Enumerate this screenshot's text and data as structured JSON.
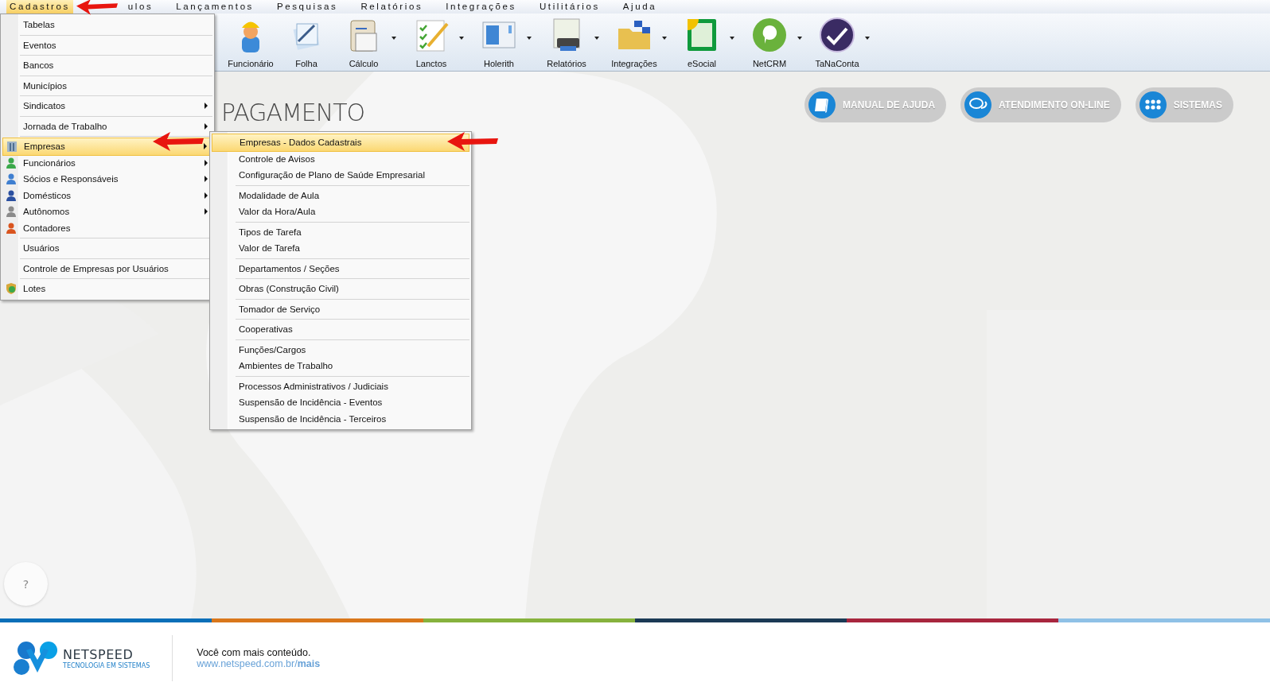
{
  "menubar": [
    {
      "label": "Cadastros",
      "selected": true
    },
    {
      "label": "ulos",
      "selected": false
    },
    {
      "label": "Lançamentos",
      "selected": false
    },
    {
      "label": "Pesquisas",
      "selected": false
    },
    {
      "label": "Relatórios",
      "selected": false
    },
    {
      "label": "Integrações",
      "selected": false
    },
    {
      "label": "Utilitários",
      "selected": false
    },
    {
      "label": "Ajuda",
      "selected": false
    }
  ],
  "toolbar": [
    {
      "label": "Funcionário",
      "kind": "worker",
      "dropdown": false
    },
    {
      "label": "Folha",
      "kind": "pages",
      "dropdown": false
    },
    {
      "label": "Cálculo",
      "kind": "calculator",
      "dropdown": true
    },
    {
      "label": "Lanctos",
      "kind": "checklist",
      "dropdown": true
    },
    {
      "label": "Holerith",
      "kind": "window",
      "dropdown": true
    },
    {
      "label": "Relatórios",
      "kind": "printer",
      "dropdown": true
    },
    {
      "label": "Integrações",
      "kind": "folder",
      "dropdown": true
    },
    {
      "label": "eSocial",
      "kind": "esocial",
      "dropdown": true
    },
    {
      "label": "NetCRM",
      "kind": "chat",
      "dropdown": true
    },
    {
      "label": "TaNaConta",
      "kind": "check",
      "dropdown": true
    }
  ],
  "page_heading": "PAGAMENTO",
  "help_buttons": [
    {
      "label": "MANUAL DE AJUDA",
      "kind": "book"
    },
    {
      "label": "ATENDIMENTO ON-LINE",
      "kind": "chat"
    },
    {
      "label": "SISTEMAS",
      "kind": "grid"
    }
  ],
  "help_circle": "?",
  "cadastros_menu": [
    [
      {
        "label": "Tabelas",
        "kind": "plain",
        "submenu": false,
        "selected": false
      }
    ],
    [
      {
        "label": "Eventos",
        "kind": "plain",
        "submenu": false,
        "selected": false
      }
    ],
    [
      {
        "label": "Bancos",
        "kind": "plain",
        "submenu": false,
        "selected": false
      }
    ],
    [
      {
        "label": "Municípios",
        "kind": "plain",
        "submenu": false,
        "selected": false
      }
    ],
    [
      {
        "label": "Sindicatos",
        "kind": "plain",
        "submenu": true,
        "selected": false
      }
    ],
    [
      {
        "label": "Jornada de Trabalho",
        "kind": "plain",
        "submenu": true,
        "selected": false
      }
    ],
    [
      {
        "label": "Empresas",
        "kind": "building",
        "submenu": true,
        "selected": true
      },
      {
        "label": "Funcionários",
        "kind": "person",
        "color": "#3aa84a",
        "submenu": true,
        "selected": false
      },
      {
        "label": "Sócios e Responsáveis",
        "kind": "person",
        "color": "#3f7fd0",
        "submenu": true,
        "selected": false
      },
      {
        "label": "Domésticos",
        "kind": "person",
        "color": "#2a4fa0",
        "submenu": true,
        "selected": false
      },
      {
        "label": "Autônomos",
        "kind": "person",
        "color": "#8a8a8a",
        "submenu": true,
        "selected": false
      },
      {
        "label": "Contadores",
        "kind": "person",
        "color": "#d9541e",
        "submenu": false,
        "selected": false
      }
    ],
    [
      {
        "label": "Usuários",
        "kind": "plain",
        "submenu": false,
        "selected": false
      }
    ],
    [
      {
        "label": "Controle de Empresas por Usuários",
        "kind": "plain",
        "submenu": false,
        "selected": false
      }
    ],
    [
      {
        "label": "Lotes",
        "kind": "shield",
        "submenu": false,
        "selected": false
      }
    ]
  ],
  "empresas_submenu": [
    [
      {
        "label": "Empresas - Dados Cadastrais",
        "selected": true
      },
      {
        "label": "Controle de Avisos",
        "selected": false
      },
      {
        "label": "Configuração de Plano de Saúde Empresarial",
        "selected": false
      }
    ],
    [
      {
        "label": "Modalidade de Aula",
        "selected": false
      },
      {
        "label": "Valor da Hora/Aula",
        "selected": false
      }
    ],
    [
      {
        "label": "Tipos de Tarefa",
        "selected": false
      },
      {
        "label": "Valor de Tarefa",
        "selected": false
      }
    ],
    [
      {
        "label": "Departamentos / Seções",
        "selected": false
      }
    ],
    [
      {
        "label": "Obras (Construção Civil)",
        "selected": false
      }
    ],
    [
      {
        "label": "Tomador de Serviço",
        "selected": false
      }
    ],
    [
      {
        "label": "Cooperativas",
        "selected": false
      }
    ],
    [
      {
        "label": "Funções/Cargos",
        "selected": false
      },
      {
        "label": "Ambientes de Trabalho",
        "selected": false
      }
    ],
    [
      {
        "label": "Processos Administrativos / Judiciais",
        "selected": false
      },
      {
        "label": "Suspensão de Incidência - Eventos",
        "selected": false
      },
      {
        "label": "Suspensão de Incidência - Terceiros",
        "selected": false
      }
    ]
  ],
  "footer": {
    "brand": "NETSPEED",
    "brand_tagline": "TECNOLOGIA EM SISTEMAS",
    "slogan": "Você com mais conteúdo.",
    "link": "www.netspeed.com.br/**mais**"
  }
}
